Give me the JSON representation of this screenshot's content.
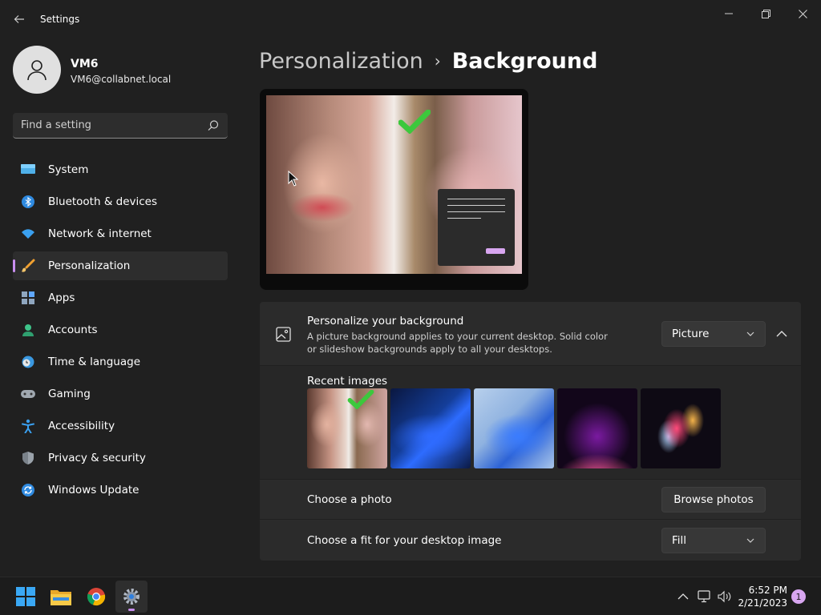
{
  "window": {
    "app_title": "Settings"
  },
  "profile": {
    "name": "VM6",
    "email": "VM6@collabnet.local"
  },
  "search": {
    "placeholder": "Find a setting"
  },
  "nav": {
    "items": [
      {
        "label": "System",
        "icon": "monitor-icon"
      },
      {
        "label": "Bluetooth & devices",
        "icon": "bluetooth-icon"
      },
      {
        "label": "Network & internet",
        "icon": "wifi-icon"
      },
      {
        "label": "Personalization",
        "icon": "paintbrush-icon",
        "active": true
      },
      {
        "label": "Apps",
        "icon": "apps-icon"
      },
      {
        "label": "Accounts",
        "icon": "person-icon"
      },
      {
        "label": "Time & language",
        "icon": "clock-globe-icon"
      },
      {
        "label": "Gaming",
        "icon": "gamepad-icon"
      },
      {
        "label": "Accessibility",
        "icon": "accessibility-icon"
      },
      {
        "label": "Privacy & security",
        "icon": "shield-icon"
      },
      {
        "label": "Windows Update",
        "icon": "sync-icon"
      }
    ]
  },
  "header": {
    "parent": "Personalization",
    "separator": "›",
    "current": "Background"
  },
  "background_setting": {
    "title": "Personalize your background",
    "description": "A picture background applies to your current desktop. Solid color or slideshow backgrounds apply to all your desktops.",
    "selected": "Picture"
  },
  "recent_images": {
    "label": "Recent images"
  },
  "choose_photo": {
    "label": "Choose a photo",
    "button": "Browse photos"
  },
  "fit": {
    "label": "Choose a fit for your desktop image",
    "selected": "Fill"
  },
  "taskbar": {
    "time": "6:52 PM",
    "date": "2/21/2023",
    "notifications": "1"
  },
  "colors": {
    "accent": "#c98ff0",
    "background": "#202020",
    "card": "#2b2b2b"
  }
}
